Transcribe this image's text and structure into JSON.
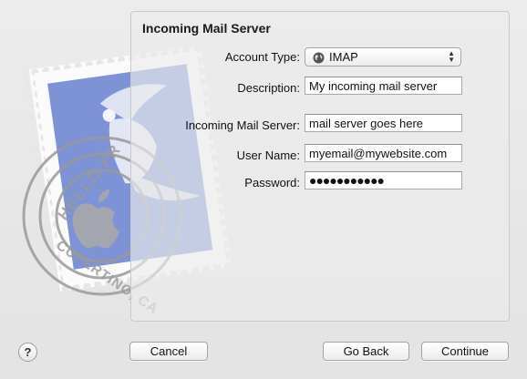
{
  "panel": {
    "title": "Incoming Mail Server"
  },
  "form": {
    "account_type": {
      "label": "Account Type:",
      "value": "IMAP",
      "icon": "globe-icon"
    },
    "description": {
      "label": "Description:",
      "value": "My incoming mail server"
    },
    "server": {
      "label": "Incoming Mail Server:",
      "value": "mail server goes here"
    },
    "username": {
      "label": "User Name:",
      "value": "myemail@mywebsite.com"
    },
    "password": {
      "label": "Password:",
      "value": "●●●●●●●●●●●"
    }
  },
  "stamp": {
    "postmark_top": "HELLO FR",
    "postmark_bottom": "CUPERTINO, CA"
  },
  "buttons": {
    "help": "?",
    "cancel": "Cancel",
    "go_back": "Go Back",
    "continue": "Continue"
  },
  "colors": {
    "stamp_blue": "#7d93d6",
    "stamp_border": "#ffffff",
    "postmark": "#9a9a9a"
  }
}
